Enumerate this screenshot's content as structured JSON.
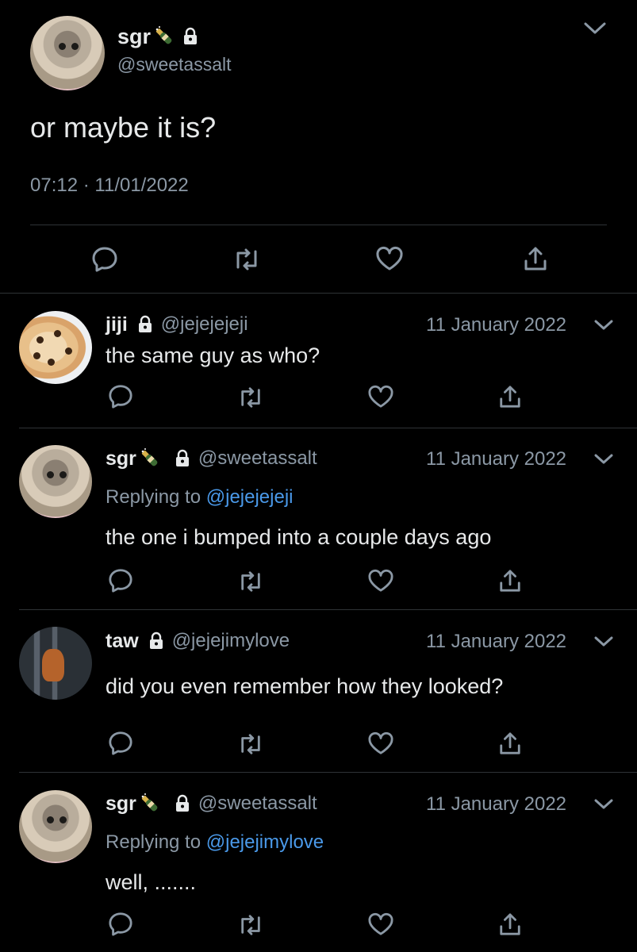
{
  "main_tweet": {
    "display_name": "sgr",
    "handle": "@sweetassalt",
    "text": "or maybe it is?",
    "time": "07:12",
    "separator": "·",
    "date": "11/01/2022"
  },
  "replies": [
    {
      "display_name": "jiji",
      "handle": "@jejejejeji",
      "date": "11 January 2022",
      "replying_label": "",
      "replying_to": "",
      "text": "the same guy as who?"
    },
    {
      "display_name": "sgr",
      "handle": "@sweetassalt",
      "date": "11 January 2022",
      "replying_label": "Replying to",
      "replying_to": "@jejejejeji",
      "text": "the one i bumped into a couple days ago"
    },
    {
      "display_name": "taw",
      "handle": "@jejejimylove",
      "date": "11 January 2022",
      "replying_label": "",
      "replying_to": "",
      "text": "did you even remember how they looked?"
    },
    {
      "display_name": "sgr",
      "handle": "@sweetassalt",
      "date": "11 January 2022",
      "replying_label": "Replying to",
      "replying_to": "@jejejimylove",
      "text": "well, ......."
    }
  ],
  "icons": [
    "chevron-down-icon",
    "champagne-icon",
    "lock-icon",
    "reply-icon",
    "retweet-icon",
    "like-icon",
    "share-icon"
  ],
  "colors": {
    "background": "#000000",
    "text": "#e7e9ea",
    "muted": "#8b98a5",
    "link": "#4a99e9",
    "divider": "#2f3336"
  }
}
